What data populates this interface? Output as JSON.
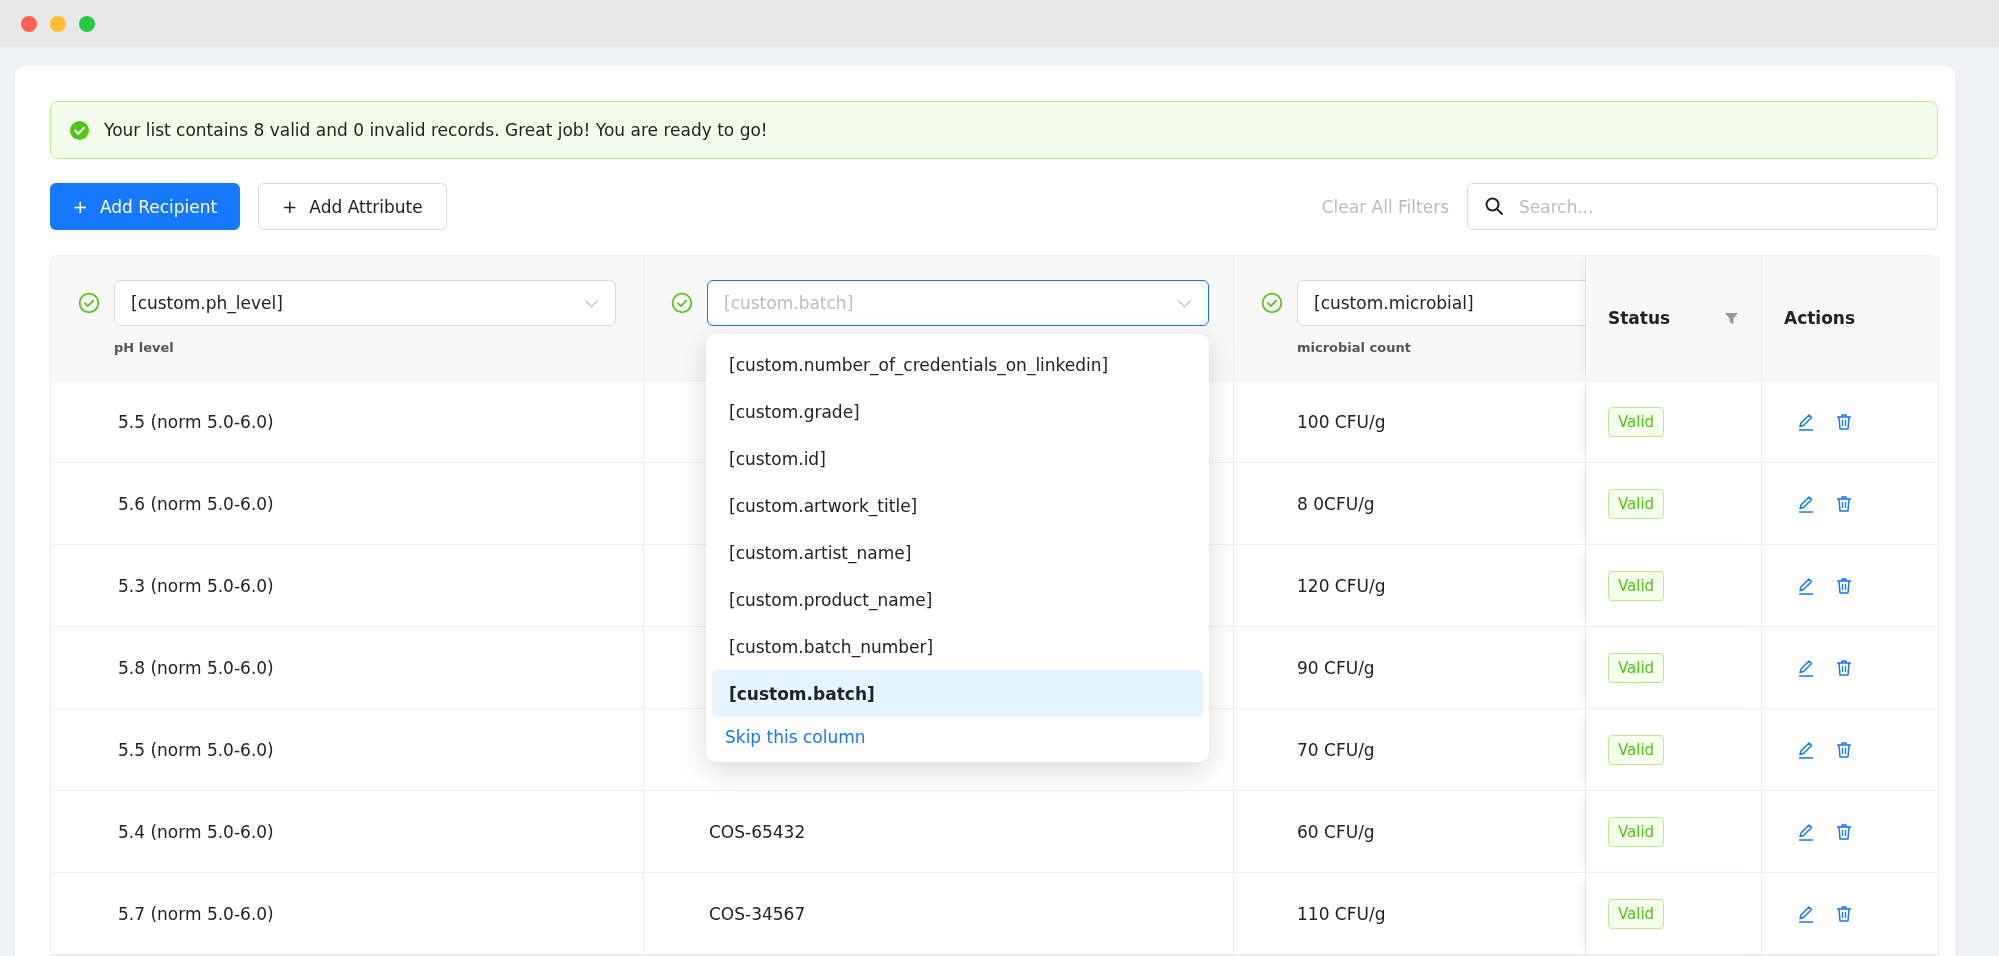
{
  "alert": {
    "text": "Your list contains 8 valid and 0 invalid records. Great job! You are ready to go!"
  },
  "toolbar": {
    "buttons": [
      {
        "icon": "+",
        "label": "Add Recipient",
        "kind": "primary"
      },
      {
        "icon": "+",
        "label": "Add Attribute",
        "kind": "default"
      }
    ],
    "clear_filters": "Clear All Filters",
    "search": {
      "placeholder": "Search..."
    }
  },
  "table": {
    "mapped_columns": [
      {
        "value": "[custom.ph_level]",
        "label": "pH level",
        "focused": false
      },
      {
        "placeholder": "[custom.batch]",
        "focused": true,
        "dropdown": {
          "options": [
            {
              "label": "[custom.number_of_credentials_on_linkedin]",
              "selected": false
            },
            {
              "label": "[custom.grade]",
              "selected": false
            },
            {
              "label": "[custom.id]",
              "selected": false
            },
            {
              "label": "[custom.artwork_title]",
              "selected": false
            },
            {
              "label": "[custom.artist_name]",
              "selected": false
            },
            {
              "label": "[custom.product_name]",
              "selected": false
            },
            {
              "label": "[custom.batch_number]",
              "selected": false
            },
            {
              "label": "[custom.batch]",
              "selected": true
            }
          ],
          "skip_link": "Skip this column"
        }
      },
      {
        "value": "[custom.microbial]",
        "label": "microbial count",
        "focused": false
      }
    ],
    "status_column": "Status",
    "actions_column": "Actions",
    "rows": [
      {
        "column_1": "5.5 (norm 5.0-6.0)",
        "column_3": "100 CFU/g",
        "status": "Valid"
      },
      {
        "column_1": "5.6 (norm 5.0-6.0)",
        "column_3": "8 0CFU/g",
        "status": "Valid"
      },
      {
        "column_1": "5.3 (norm 5.0-6.0)",
        "column_3": "120 CFU/g",
        "status": "Valid"
      },
      {
        "column_1": "5.8 (norm 5.0-6.0)",
        "column_3": "90 CFU/g",
        "status": "Valid"
      },
      {
        "column_1": "5.5 (norm 5.0-6.0)",
        "column_3": "70 CFU/g",
        "status": "Valid"
      },
      {
        "column_1": "5.4 (norm 5.0-6.0)",
        "column_2": "COS-65432",
        "column_3": "60 CFU/g",
        "status": "Valid"
      },
      {
        "column_1": "5.7 (norm 5.0-6.0)",
        "column_2": "COS-34567",
        "column_3": "110 CFU/g",
        "status": "Valid"
      }
    ]
  }
}
